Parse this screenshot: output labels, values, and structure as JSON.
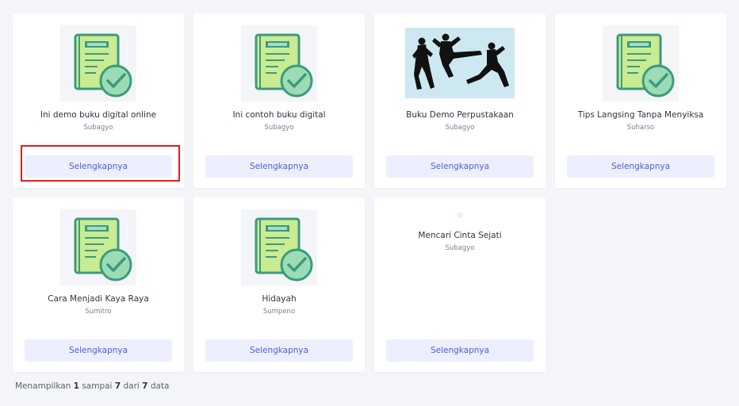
{
  "books": [
    {
      "title": "Ini demo buku digital online",
      "author": "Subagyo",
      "button": "Selengkapnya",
      "image": "book-icon"
    },
    {
      "title": "Ini contoh buku digital",
      "author": "Subagyo",
      "button": "Selengkapnya",
      "image": "book-icon"
    },
    {
      "title": "Buku Demo Perpustakaan",
      "author": "Subagyo",
      "button": "Selengkapnya",
      "image": "martial-arts-silhouette"
    },
    {
      "title": "Tips Langsing Tanpa Menyiksa",
      "author": "Suharso",
      "button": "Selengkapnya",
      "image": "book-icon"
    },
    {
      "title": "Cara Menjadi Kaya Raya",
      "author": "Sumitro",
      "button": "Selengkapnya",
      "image": "book-icon"
    },
    {
      "title": "Hidayah",
      "author": "Sumpeno",
      "button": "Selengkapnya",
      "image": "book-icon"
    },
    {
      "title": "Mencari Cinta Sejati",
      "author": "Subagyo",
      "button": "Selengkapnya",
      "image": "broken-image-placeholder"
    }
  ],
  "footer": {
    "prefix": "Menampilkan",
    "from": "1",
    "mid1": "sampai",
    "to": "7",
    "mid2": "dari",
    "total": "7",
    "suffix": "data"
  },
  "colors": {
    "page_bg": "#f4f5f9",
    "card_bg": "#ffffff",
    "button_bg": "#edeffe",
    "button_text": "#4a5fd8",
    "highlight": "#e31b23",
    "book_green": "#3d9a7e",
    "book_light": "#c9ec92",
    "thumb_bg": "#f4f5f9",
    "martial_bg": "#cde8f0"
  }
}
